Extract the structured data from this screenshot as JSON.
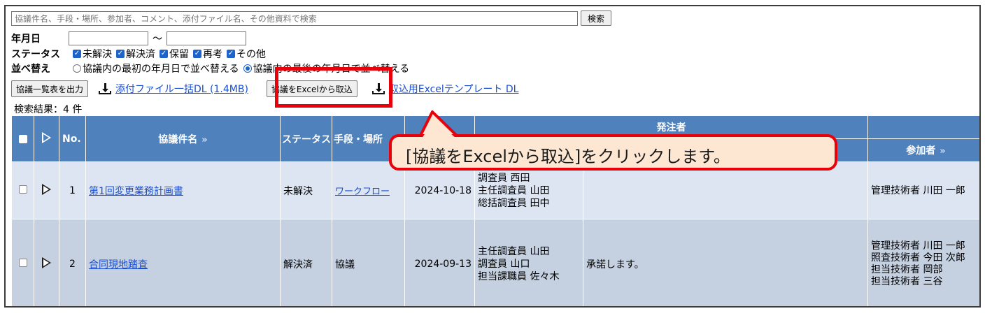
{
  "search": {
    "placeholder": "協議件名、手段・場所、参加者、コメント、添付ファイル名、その他資料で検索",
    "button_label": "検索"
  },
  "filters": {
    "date_label": "年月日",
    "date_separator": "～",
    "status_label": "ステータス",
    "status_options": [
      "未解決",
      "解決済",
      "保留",
      "再考",
      "その他"
    ],
    "sort_label": "並べ替え",
    "sort_options": [
      "協議内の最初の年月日で並べ替える",
      "協議内の最後の年月日で並べ替える"
    ],
    "sort_selected_index": 1
  },
  "toolbar": {
    "export_list_label": "協議一覧表を出力",
    "bulk_download_label": "添付ファイル一括DL (1.4MB)",
    "import_excel_label": "協議をExcelから取込",
    "template_download_label": "取込用Excelテンプレート DL"
  },
  "result_count": "検索結果：4 件",
  "table": {
    "headers": {
      "no": "No.",
      "title": "協議件名",
      "status": "ステータス",
      "method": "手段・場所",
      "issuer": "発注者",
      "participants": "参加者"
    },
    "rows": [
      {
        "no": "1",
        "title": "第1回変更業務計画書",
        "status": "未解決",
        "method": "ワークフロー",
        "date": "2024-10-18",
        "persons": [
          "調査員 西田",
          "主任調査員 山田",
          "総括調査員 田中"
        ],
        "comment": "",
        "participants": [
          "管理技術者 川田 一郎"
        ]
      },
      {
        "no": "2",
        "title": "合同現地踏査",
        "status": "解決済",
        "method": "協議",
        "date": "2024-09-13",
        "persons": [
          "主任調査員 山田",
          "調査員 山口",
          "担当課職員 佐々木"
        ],
        "comment": "承諾します。",
        "participants": [
          "管理技術者 川田 一郎",
          "照査技術者 今田 次郎",
          "担当技術者 岡部",
          "担当技術者 三谷"
        ]
      }
    ]
  },
  "annotation": {
    "callout_text": "[協議をExcelから取込]をクリックします。",
    "highlight_color": "#e8000a",
    "callout_bg": "#fde7d3"
  },
  "colors": {
    "header_bg": "#4f81bd",
    "row_light": "#dde5f2",
    "row_dark": "#c5d0e0",
    "link": "#1a4fd1",
    "checkbox": "#1e63c9"
  }
}
